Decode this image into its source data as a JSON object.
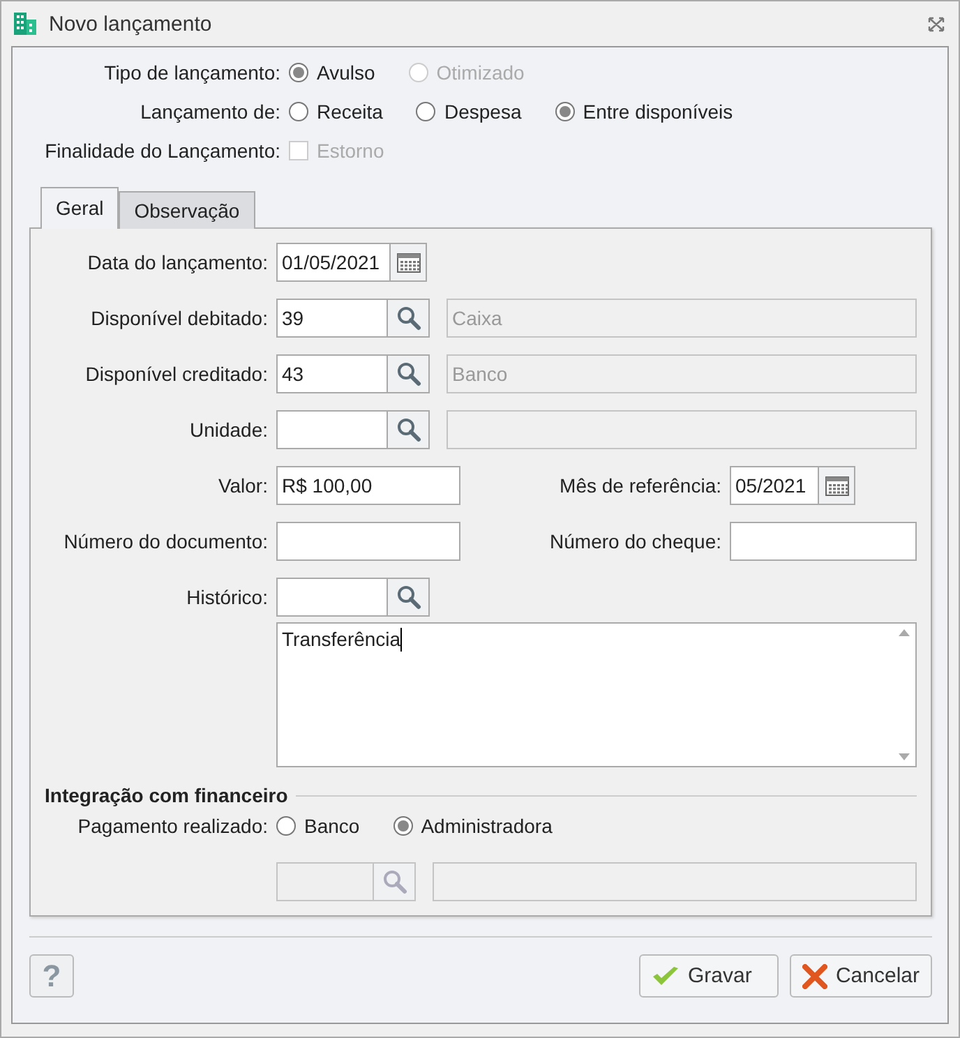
{
  "window": {
    "title": "Novo lançamento"
  },
  "tipo": {
    "label": "Tipo de lançamento:",
    "options": [
      {
        "label": "Avulso",
        "selected": true,
        "disabled": false
      },
      {
        "label": "Otimizado",
        "selected": false,
        "disabled": true
      }
    ]
  },
  "lancamento_de": {
    "label": "Lançamento de:",
    "options": [
      {
        "label": "Receita",
        "selected": false,
        "disabled": false
      },
      {
        "label": "Despesa",
        "selected": false,
        "disabled": false
      },
      {
        "label": "Entre disponíveis",
        "selected": true,
        "disabled": false
      }
    ]
  },
  "finalidade": {
    "label": "Finalidade do Lançamento:",
    "checkbox": {
      "label": "Estorno",
      "checked": false,
      "disabled": true
    }
  },
  "tabs": [
    {
      "label": "Geral",
      "selected": true
    },
    {
      "label": "Observação",
      "selected": false
    }
  ],
  "rows": [
    {
      "kind": "date",
      "label": "Data do lançamento:",
      "value": "01/05/2021"
    },
    {
      "kind": "lookup",
      "label": "Disponível debitado:",
      "code": "39",
      "description": "Caixa"
    },
    {
      "kind": "lookup",
      "label": "Disponível creditado:",
      "code": "43",
      "description": "Banco"
    },
    {
      "kind": "lookup",
      "label": "Unidade:"
    },
    {
      "kind": "pair",
      "label": "Valor:",
      "value": "R$ 100,00",
      "right": {
        "kind": "month",
        "label": "Mês de referência:",
        "value": "05/2021"
      }
    },
    {
      "kind": "pair",
      "label": "Número do documento:",
      "right": {
        "kind": "text",
        "label": "Número do cheque:"
      }
    },
    {
      "kind": "search",
      "label": "Histórico:"
    }
  ],
  "historico_text": "Transferência",
  "integracao": {
    "title": "Integração com financeiro",
    "label": "Pagamento realizado:",
    "options": [
      {
        "label": "Banco",
        "selected": false,
        "disabled": false
      },
      {
        "label": "Administradora",
        "selected": true,
        "disabled": false
      }
    ],
    "lookup_disabled": true
  },
  "buttons": [
    {
      "kind": "help",
      "label": "?"
    },
    {
      "kind": "ok",
      "label": "Gravar"
    },
    {
      "kind": "cancel",
      "label": "Cancelar"
    }
  ]
}
